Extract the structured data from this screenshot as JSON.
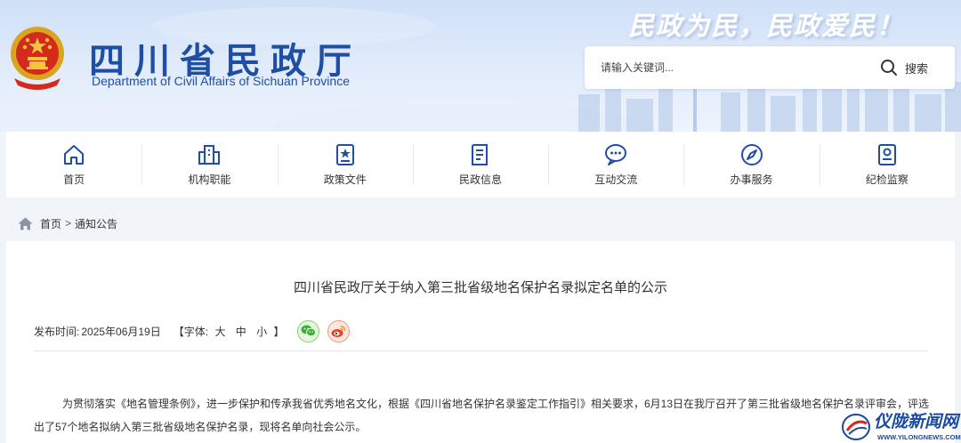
{
  "header": {
    "title_cn": "四川省民政厅",
    "title_en": "Department of Civil Affairs of Sichuan Province",
    "slogan": "民政为民，民政爱民！",
    "search": {
      "placeholder": "请输入关键词...",
      "button_label": "搜索",
      "icon": "search-icon"
    }
  },
  "nav": {
    "items": [
      {
        "label": "首页",
        "icon": "home-icon"
      },
      {
        "label": "机构职能",
        "icon": "building-icon"
      },
      {
        "label": "政策文件",
        "icon": "document-star-icon"
      },
      {
        "label": "民政信息",
        "icon": "news-icon"
      },
      {
        "label": "互动交流",
        "icon": "chat-icon"
      },
      {
        "label": "办事服务",
        "icon": "compass-icon"
      },
      {
        "label": "纪检监察",
        "icon": "badge-icon"
      }
    ]
  },
  "breadcrumb": {
    "home": "首页",
    "separator": ">",
    "current": "通知公告"
  },
  "article": {
    "title": "四川省民政厅关于纳入第三批省级地名保护名录拟定名单的公示",
    "publish_label": "发布时间:",
    "publish_date": "2025年06月19日",
    "font_label_open": "【字体:",
    "font_large": "大",
    "font_medium": "中",
    "font_small": "小",
    "font_label_close": "】",
    "body": "为贯彻落实《地名管理条例》，进一步保护和传承我省优秀地名文化，根据《四川省地名保护名录鉴定工作指引》相关要求，6月13日在我厅召开了第三批省级地名保护名录评审会，评选出了57个地名拟纳入第三批省级地名保护名录，现将名单向社会公示。"
  },
  "watermark": {
    "text_cn": "仪陇新闻网",
    "text_en": "WWW.YILONGNEWS.COM"
  },
  "colors": {
    "brand_blue": "#1f4fa5",
    "nav_icon": "#1f4fa5",
    "page_bg": "#f1f4f9"
  }
}
